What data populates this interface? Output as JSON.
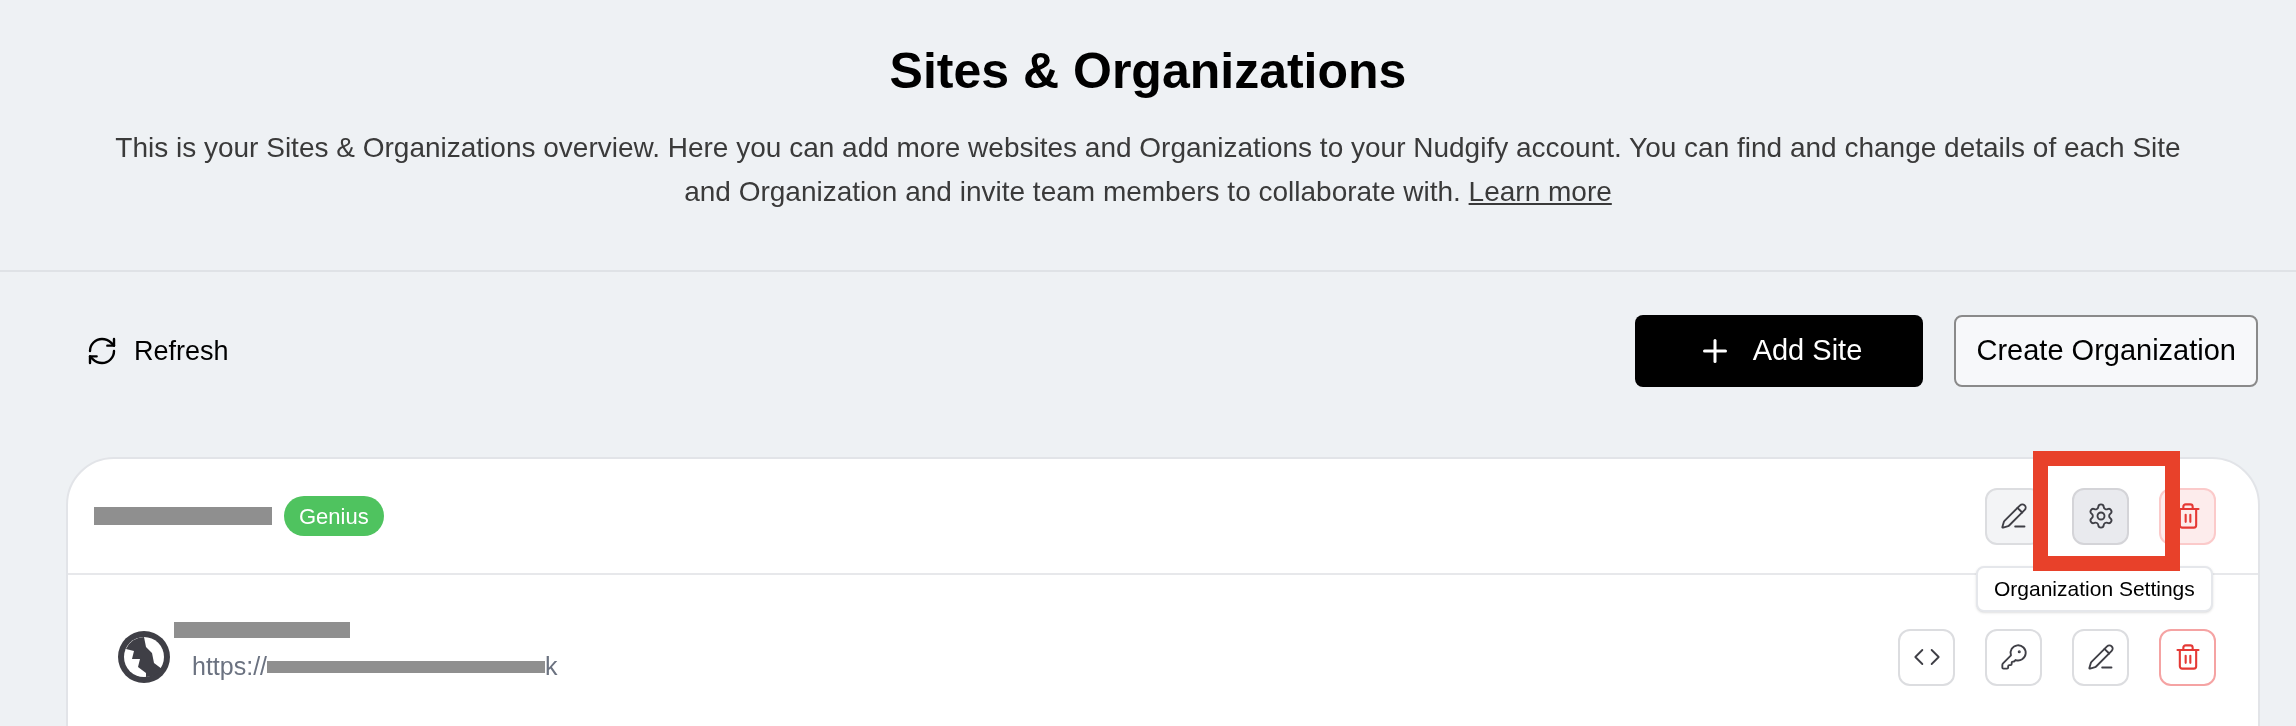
{
  "header": {
    "title": "Sites & Organizations",
    "description": "This is your Sites & Organizations overview. Here you can add more websites and Organizations to your Nudgify account. You can find and change details of each Site and Organization and invite team members to collaborate with.",
    "link": "Learn more"
  },
  "toolbar": {
    "refresh": "Refresh",
    "buttons": [
      {
        "label": "Add Site",
        "kind": "primary"
      },
      {
        "label": "Create Organization",
        "kind": "outline"
      }
    ]
  },
  "organization": {
    "badge": "Genius",
    "actions": [
      {
        "kind": "edit"
      },
      {
        "kind": "settings"
      },
      {
        "kind": "delete"
      }
    ],
    "tooltip": "Organization Settings"
  },
  "sites": [
    {
      "url_start": "https://",
      "url_end": "k",
      "actions": [
        {
          "kind": "code"
        },
        {
          "kind": "key"
        },
        {
          "kind": "edit"
        },
        {
          "kind": "delete"
        }
      ]
    }
  ]
}
